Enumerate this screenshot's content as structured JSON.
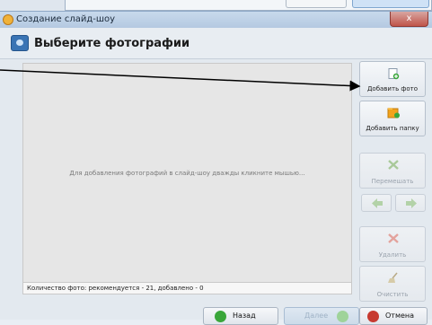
{
  "dialog": {
    "title": "Создание слайд-шоу",
    "close_label": "x",
    "header_title": "Выберите фотографии"
  },
  "photo_area": {
    "hint": "Для добавления фотографий в слайд-шоу дважды кликните мышью..."
  },
  "status": {
    "text": "Количество фото: рекомендуется - 21, добавлено - 0"
  },
  "side_buttons": {
    "add_photo": "Добавить фото",
    "add_folder": "Добавить папку",
    "shuffle": "Перемешать",
    "delete": "Удалить",
    "clear": "Очистить"
  },
  "footer": {
    "back": "Назад",
    "next": "Далее",
    "cancel": "Отмена"
  },
  "colors": {
    "accent_green": "#3aa63a",
    "cancel_red": "#c73a30",
    "folder_orange": "#f2a31b"
  }
}
